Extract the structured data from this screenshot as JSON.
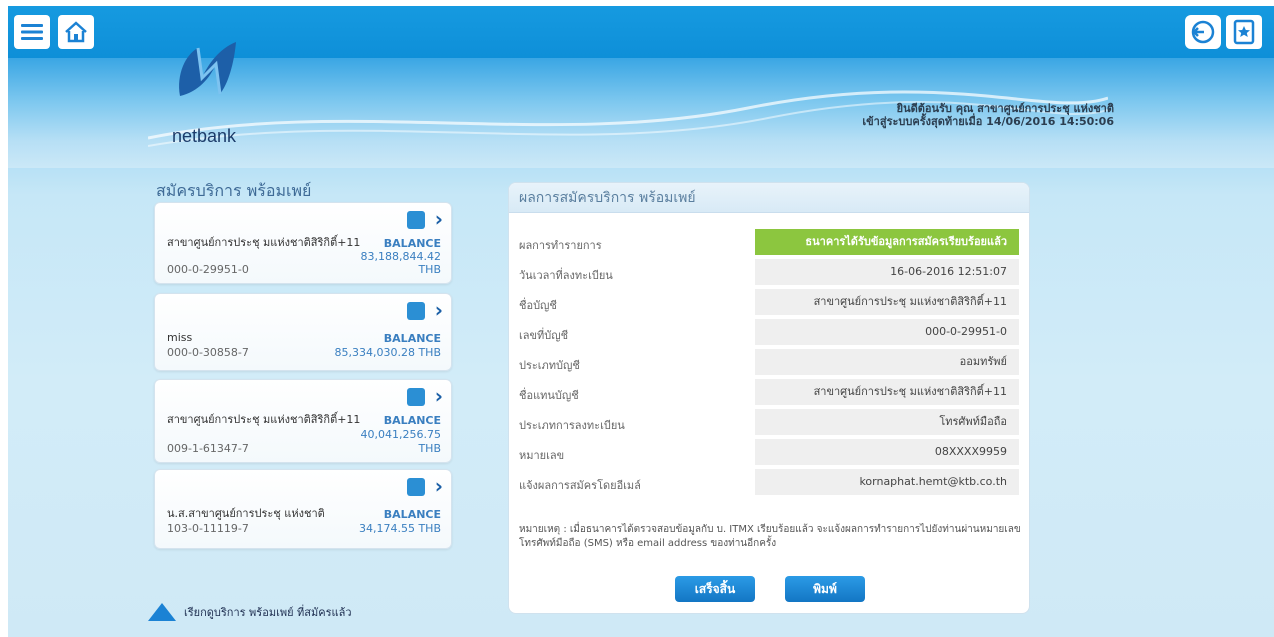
{
  "topbar": {
    "menu_icon": "hamburger-menu-icon",
    "home_icon": "home-icon",
    "logout_icon": "logout-icon",
    "favorite_icon": "bookmark-star-icon"
  },
  "header": {
    "logo_text": "netbank",
    "welcome_line1": "ยินดีต้อนรับ คุณ สาขาศูนย์การประชุ แห่งชาติ",
    "welcome_line2": "เข้าสู่ระบบครั้งสุดท้ายเมื่อ 14/06/2016 14:50:06"
  },
  "left": {
    "title": "สมัครบริการ พร้อมเพย์",
    "accounts": [
      {
        "name": "สาขาศูนย์การประชุ มแห่งชาติสิริกิติ์+11",
        "number": "000-0-29951-0",
        "balance_label": "BALANCE",
        "balance": "83,188,844.42",
        "currency": "THB"
      },
      {
        "name": "miss",
        "number": "000-0-30858-7",
        "balance_label": "BALANCE",
        "balance": "85,334,030.28 THB",
        "currency": ""
      },
      {
        "name": "สาขาศูนย์การประชุ มแห่งชาติสิริกิติ์+11",
        "number": "009-1-61347-7",
        "balance_label": "BALANCE",
        "balance": "40,041,256.75",
        "currency": "THB"
      },
      {
        "name": "น.ส.สาขาศูนย์การประชุ แห่งชาติ",
        "number": "103-0-11119-7",
        "balance_label": "BALANCE",
        "balance": "34,174.55 THB",
        "currency": ""
      }
    ],
    "view_link": "เรียกดูบริการ พร้อมเพย์ ที่สมัครแล้ว"
  },
  "panel": {
    "title": "ผลการสมัครบริการ พร้อมเพย์",
    "rows": [
      {
        "label": "ผลการทำรายการ",
        "value": "ธนาคารได้รับข้อมูลการสมัครเรียบร้อยแล้ว"
      },
      {
        "label": "วันเวลาที่ลงทะเบียน",
        "value": "16-06-2016 12:51:07"
      },
      {
        "label": "ชื่อบัญชี",
        "value": "สาขาศูนย์การประชุ มแห่งชาติสิริกิติ์+11"
      },
      {
        "label": "เลขที่บัญชี",
        "value": "000-0-29951-0"
      },
      {
        "label": "ประเภทบัญชี",
        "value": "ออมทรัพย์"
      },
      {
        "label": "ชื่อแทนบัญชี",
        "value": "สาขาศูนย์การประชุ มแห่งชาติสิริกิติ์+11"
      },
      {
        "label": "ประเภทการลงทะเบียน",
        "value": "โทรศัพท์มือถือ"
      },
      {
        "label": "หมายเลข",
        "value": "08XXXX9959"
      },
      {
        "label": "แจ้งผลการสมัครโดยอีเมล์",
        "value": "kornaphat.hemt@ktb.co.th"
      }
    ],
    "note": "หมายเหตุ : เมื่อธนาคารได้ตรวจสอบข้อมูลกับ บ. ITMX เรียบร้อยแล้ว จะแจ้งผลการทำรายการไปยังท่านผ่านหมายเลขโทรศัพท์มือถือ (SMS) หรือ email address ของท่านอีกครั้ง",
    "finish_label": "เสร็จสิ้น",
    "print_label": "พิมพ์"
  },
  "colors": {
    "topbar": "#169ae0",
    "success": "#8cc63f",
    "button": "#1b82d4"
  }
}
